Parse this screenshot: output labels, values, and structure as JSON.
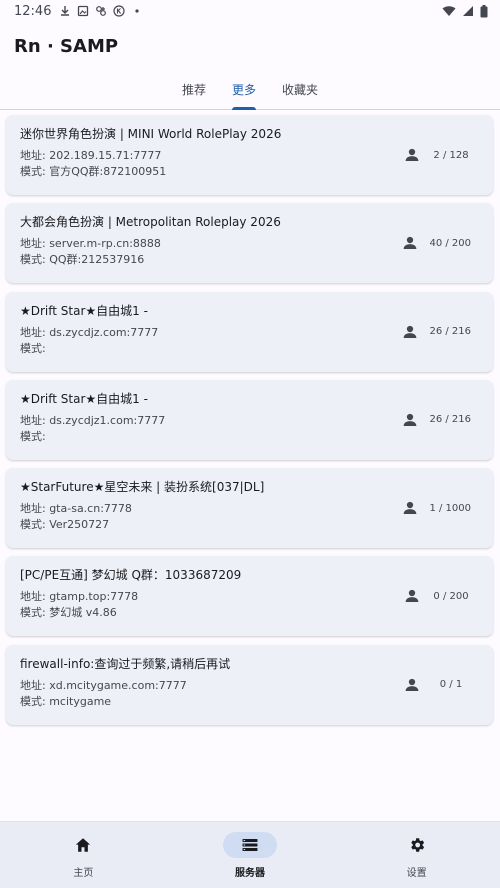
{
  "status_bar": {
    "time": "12:46",
    "icons": [
      "download-icon",
      "photo-icon",
      "game-icon",
      "k-icon",
      "dot-icon"
    ],
    "right_icons": [
      "wifi-icon",
      "signal-icon",
      "battery-icon"
    ]
  },
  "app": {
    "title": "Rn · SAMP"
  },
  "tabs": [
    {
      "label": "推荐",
      "active": false
    },
    {
      "label": "更多",
      "active": true
    },
    {
      "label": "收藏夹",
      "active": false
    }
  ],
  "servers": [
    {
      "title": "迷你世界角色扮演 | MINI World RolePlay 2026",
      "address": "地址:  202.189.15.71:7777",
      "mode": "模式:  官方QQ群:872100951",
      "players": "2 / 128"
    },
    {
      "title": "大都会角色扮演 | Metropolitan Roleplay 2026",
      "address": "地址:  server.m-rp.cn:8888",
      "mode": "模式:  QQ群:212537916",
      "players": "40 / 200"
    },
    {
      "title": "★Drift Star★自由城1 -",
      "address": "地址:  ds.zycdjz.com:7777",
      "mode": "模式:",
      "players": "26 / 216"
    },
    {
      "title": "★Drift Star★自由城1 -",
      "address": "地址:  ds.zycdjz1.com:7777",
      "mode": "模式:",
      "players": "26 / 216"
    },
    {
      "title": "★StarFuture★星空未来 | 装扮系统[037|DL]",
      "address": "地址:  gta-sa.cn:7778",
      "mode": "模式:  Ver250727",
      "players": "1 / 1000"
    },
    {
      "title": "[PC/PE互通] 梦幻城 Q群：1033687209",
      "address": "地址:  gtamp.top:7778",
      "mode": "模式:  梦幻城 v4.86",
      "players": "0 / 200"
    },
    {
      "title": "firewall-info:查询过于频繁,请稍后再试",
      "address": "地址:  xd.mcitygame.com:7777",
      "mode": "模式:  mcitygame",
      "players": "0 / 1"
    }
  ],
  "bottom_nav": [
    {
      "label": "主页",
      "icon": "home-icon",
      "active": false
    },
    {
      "label": "服务器",
      "icon": "server-list-icon",
      "active": true
    },
    {
      "label": "设置",
      "icon": "gear-icon",
      "active": false
    }
  ],
  "colors": {
    "accent": "#1f5fa8",
    "card_bg": "#eef0f7",
    "nav_bg": "#e9ecf4"
  }
}
